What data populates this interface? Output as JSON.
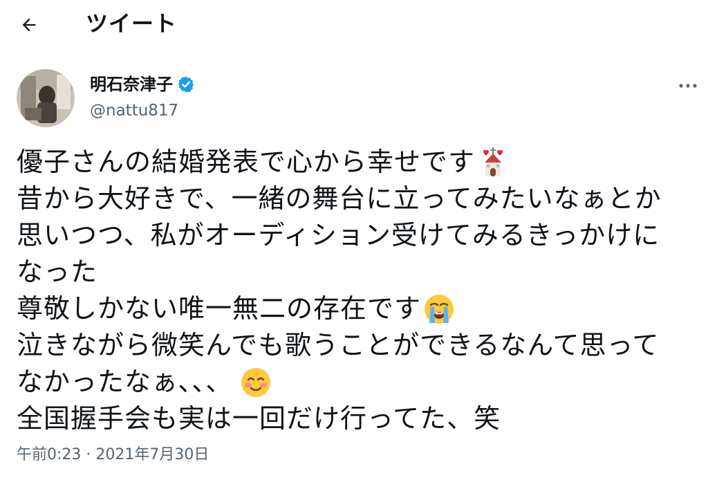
{
  "header": {
    "title": "ツイート",
    "back_icon": "arrow-left-icon"
  },
  "author": {
    "display_name": "明石奈津子",
    "handle": "@nattu817",
    "verified": true,
    "verified_color": "#1d9bf0"
  },
  "tweet": {
    "lines": [
      "優子さんの結婚発表で心から幸せです",
      "昔から大好きで、一緒の舞台に立ってみたいなぁとか",
      "思いつつ、私がオーディション受けてみるきっかけに",
      "なった",
      "尊敬しかない唯一無二の存在です",
      "泣きながら微笑んでも歌うことができるなんて思って",
      "なかったなぁ、、、",
      "全国握手会も実は一回だけ行ってた、笑"
    ],
    "emojis": {
      "line0": "wedding-chapel-emoji",
      "line4": "loudly-crying-face-emoji",
      "line6": "smiling-face-emoji"
    },
    "timestamp": "午前0:23 · 2021年7月30日"
  },
  "colors": {
    "text": "#0f1419",
    "secondary": "#536471",
    "accent": "#1d9bf0"
  }
}
